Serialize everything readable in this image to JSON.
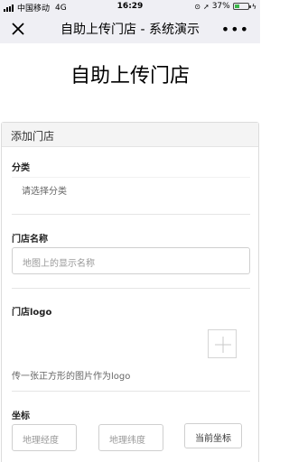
{
  "status_bar": {
    "carrier": "中国移动",
    "network": "4G",
    "time": "16:29",
    "battery_percent": "37%",
    "battery_level": 0.37
  },
  "nav": {
    "title": "自助上传门店 - 系统演示",
    "more_label": "•••"
  },
  "page": {
    "title": "自助上传门店"
  },
  "form": {
    "header": "添加门店",
    "category": {
      "label": "分类",
      "placeholder": "请选择分类"
    },
    "store_name": {
      "label": "门店名称",
      "placeholder": "地图上的显示名称"
    },
    "logo": {
      "label": "门店logo",
      "help": "传一张正方形的图片作为logo"
    },
    "coords": {
      "label": "坐标",
      "longitude_placeholder": "地理经度",
      "latitude_placeholder": "地理纬度",
      "current_button": "当前坐标"
    }
  },
  "colors": {
    "nav_bg": "#efeff4",
    "battery_green": "#3bb54a",
    "card_header_bg": "#f4f4f4"
  }
}
